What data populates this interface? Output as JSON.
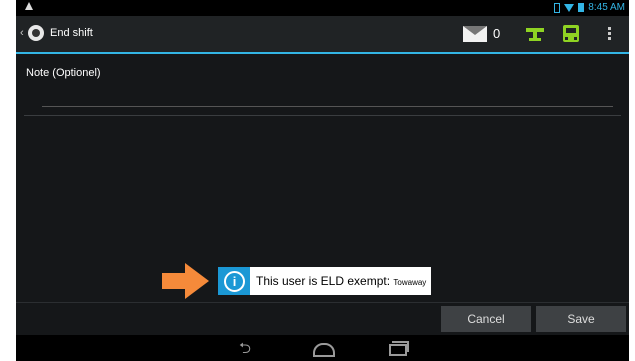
{
  "status_bar": {
    "time": "8:45 AM"
  },
  "action_bar": {
    "back_caret": "‹",
    "title": "End shift",
    "message_count": "0"
  },
  "note": {
    "label": "Note (Optionel)",
    "value": "",
    "placeholder": ""
  },
  "toast": {
    "message": "This user is ELD exempt: ",
    "reason": "Towaway",
    "info_glyph": "i"
  },
  "buttons": {
    "cancel": "Cancel",
    "save": "Save"
  },
  "nav": {
    "back_glyph": "⮌"
  },
  "colors": {
    "accent": "#33b5e5",
    "green_icons": "#8fd323",
    "toast_blue": "#1b98d5",
    "arrow": "#f58a3a"
  }
}
